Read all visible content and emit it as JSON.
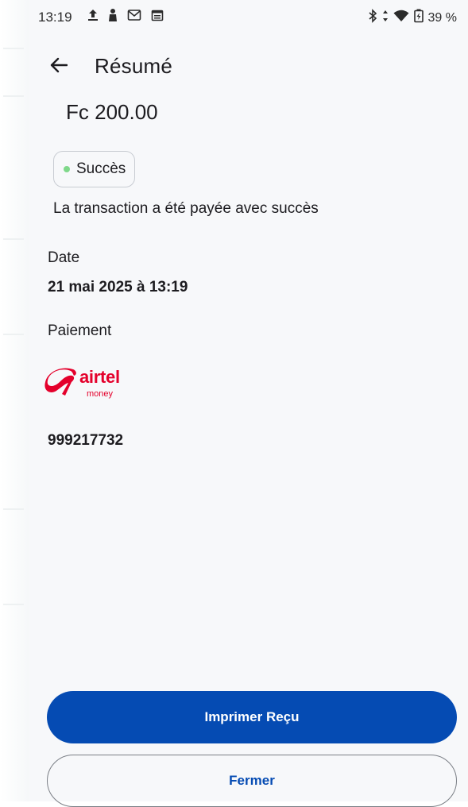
{
  "status_bar": {
    "time": "13:19",
    "battery_text": "39 %",
    "icons_left": [
      "upload-icon",
      "person-icon",
      "gmail-icon",
      "calendar-icon"
    ],
    "icons_right": [
      "bluetooth-icon",
      "data-arrows-icon",
      "wifi-icon",
      "battery-icon"
    ]
  },
  "header": {
    "title": "Résumé",
    "back_icon": "arrow-left-icon"
  },
  "summary": {
    "amount": "Fc 200.00",
    "status_chip": {
      "label": "Succès",
      "dot_color": "#7fd88a"
    },
    "status_message": "La transaction a été payée avec succès",
    "date_label": "Date",
    "date_value": "21 mai 2025 à 13:19",
    "payment_label": "Paiement",
    "payment_provider": {
      "name": "airtel",
      "subtitle": "money",
      "brand_color": "#e4002b"
    },
    "account_number": "999217732"
  },
  "actions": {
    "print_label": "Imprimer Reçu",
    "close_label": "Fermer"
  },
  "colors": {
    "primary": "#054bb3",
    "background": "#f7f8fa",
    "text": "#1c1b1f"
  }
}
